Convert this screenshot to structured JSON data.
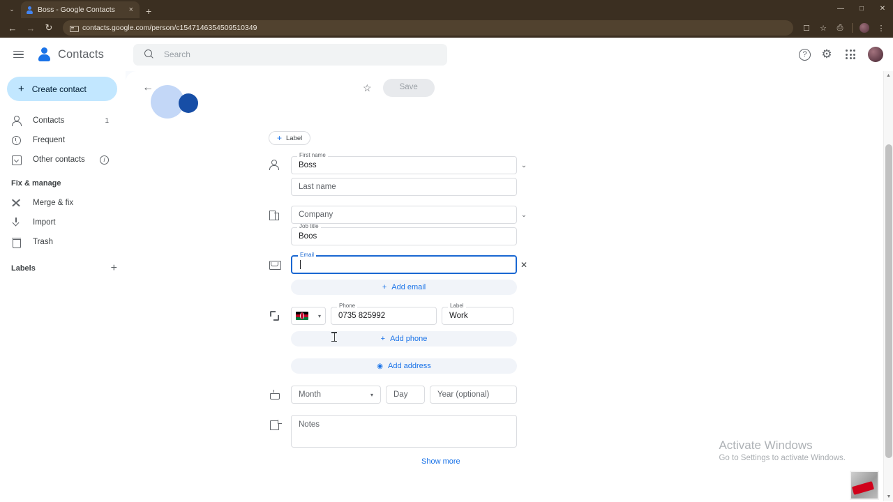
{
  "browser": {
    "tab": {
      "title": "Boss - Google Contacts",
      "favicon": "contacts-favicon",
      "close_label": "×"
    },
    "new_tab_label": "+",
    "tab_list_label": "⌄",
    "nav": {
      "back": "←",
      "forward": "→",
      "reload": "↻"
    },
    "url": "contacts.google.com/person/c1547146354509510349",
    "toolbar_icons": [
      "cast-icon",
      "bookmark-star-icon",
      "extensions-icon",
      "profile-avatar",
      "more-menu-icon"
    ],
    "window_controls": {
      "minimize": "—",
      "maximize": "□",
      "close": "✕"
    }
  },
  "app": {
    "brand_name": "Contacts",
    "search": {
      "placeholder": "Search"
    },
    "header_icons": {
      "help": "?",
      "settings": "⚙",
      "apps": "apps-grid-icon",
      "account": "account-avatar"
    }
  },
  "sidebar": {
    "create_contact_label": "Create contact",
    "items": [
      {
        "label": "Contacts",
        "icon": "person-icon",
        "count": "1"
      },
      {
        "label": "Frequent",
        "icon": "clock-icon",
        "count": ""
      },
      {
        "label": "Other contacts",
        "icon": "box-arrow-icon",
        "count": ""
      }
    ],
    "section_title": "Fix & manage",
    "manage_items": [
      {
        "label": "Merge & fix",
        "icon": "wrench-icon"
      },
      {
        "label": "Import",
        "icon": "download-icon"
      },
      {
        "label": "Trash",
        "icon": "trash-icon"
      }
    ],
    "labels_title": "Labels",
    "labels_add": "+"
  },
  "detail": {
    "back_label": "←",
    "star_label": "☆",
    "save_label": "Save",
    "label_chip": {
      "plus": "+",
      "text": "Label"
    },
    "fields": {
      "first_name": {
        "label": "First name",
        "value": "Boss"
      },
      "last_name": {
        "label": "",
        "placeholder": "Last name",
        "value": ""
      },
      "company": {
        "label": "",
        "placeholder": "Company",
        "value": ""
      },
      "job_title": {
        "label": "Job title",
        "value": "Boos"
      },
      "email": {
        "label": "Email",
        "value": "",
        "focused": true
      },
      "phone": {
        "label": "Phone",
        "value": "0735 825992"
      },
      "phone_label": {
        "label": "Label",
        "value": "Work"
      },
      "country_flag": "kenya-flag",
      "birthday_month": {
        "placeholder": "Month"
      },
      "birthday_day": {
        "placeholder": "Day"
      },
      "birthday_year": {
        "placeholder": "Year (optional)"
      },
      "notes": {
        "placeholder": "Notes"
      }
    },
    "add_email_label": "Add email",
    "add_phone_label": "Add phone",
    "add_address_label": "Add address",
    "show_more_label": "Show more",
    "clear_email_label": "✕",
    "expand_name_label": "⌄",
    "expand_company_label": "⌄",
    "month_dropdown_label": "▾"
  },
  "watermark": {
    "title": "Activate Windows",
    "subtitle": "Go to Settings to activate Windows."
  },
  "colors": {
    "accent_blue": "#1a73e8",
    "create_contact_bg": "#c2e7ff",
    "focus_border": "#1967d2",
    "chrome_bg": "#3b2f21"
  }
}
